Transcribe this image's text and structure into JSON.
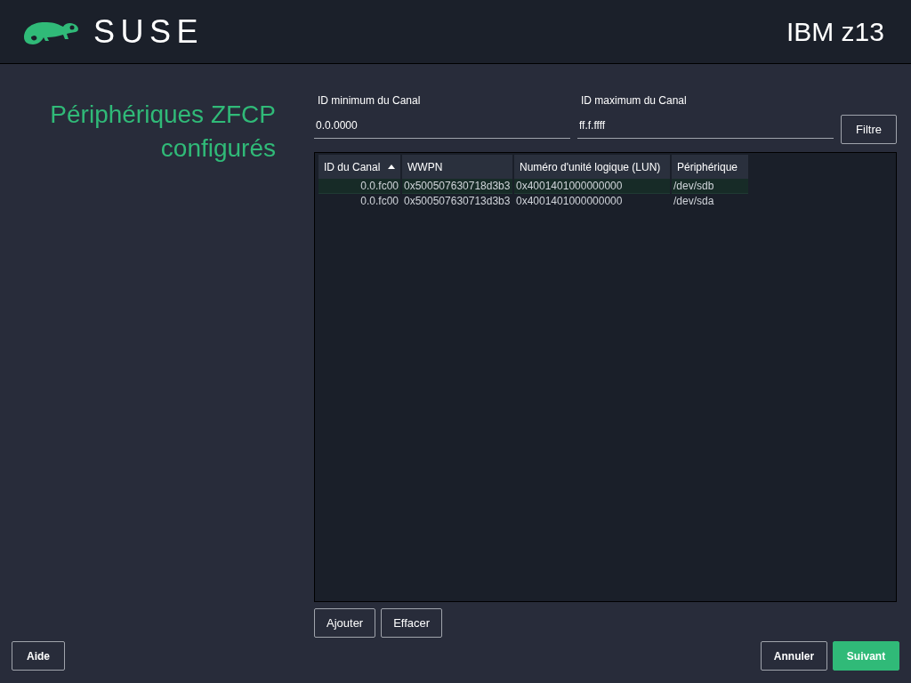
{
  "header": {
    "logo_text": "SUSE",
    "machine": "IBM z13"
  },
  "title": "Périphériques ZFCP configurés",
  "filters": [
    {
      "label": "ID minimum du Canal",
      "value": "0.0.0000"
    },
    {
      "label": "ID maximum du Canal",
      "value": "ff.f.ffff"
    }
  ],
  "filter_button": "Filtre",
  "table": {
    "columns": [
      {
        "label": "ID du Canal",
        "sorted": true
      },
      {
        "label": "WWPN",
        "sorted": false
      },
      {
        "label": "Numéro d'unité logique (LUN)",
        "sorted": false
      },
      {
        "label": "Périphérique",
        "sorted": false
      }
    ],
    "rows": [
      {
        "selected": true,
        "cells": [
          "0.0.fc00",
          "0x500507630718d3b3",
          "0x4001401000000000",
          "/dev/sdb"
        ]
      },
      {
        "selected": false,
        "cells": [
          "0.0.fc00",
          "0x500507630713d3b3",
          "0x4001401000000000",
          "/dev/sda"
        ]
      }
    ]
  },
  "table_buttons": [
    "Ajouter",
    "Effacer"
  ],
  "footer": {
    "help": "Aide",
    "buttons": [
      {
        "label": "Annuler",
        "kind": "secondary"
      },
      {
        "label": "Suivant",
        "kind": "primary"
      }
    ]
  }
}
